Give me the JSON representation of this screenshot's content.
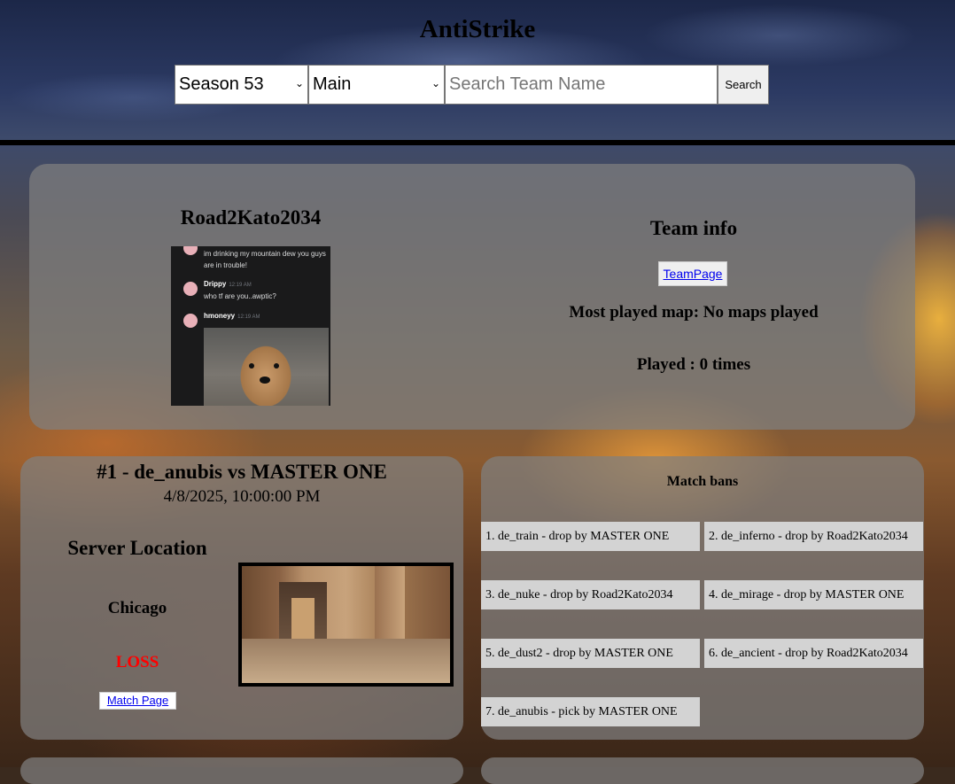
{
  "site": {
    "title": "AntiStrike"
  },
  "search": {
    "season_selected": "Season 53",
    "division_selected": "Main",
    "placeholder": "Search Team Name",
    "button_label": "Search"
  },
  "team": {
    "name": "Road2Kato2034",
    "avatar_chat": [
      {
        "name": "",
        "time": "",
        "text": "im drinking my mountain dew you guys are in trouble!"
      },
      {
        "name": "Drippy",
        "time": "12:19 AM",
        "text": "who tf are you..awptic?"
      },
      {
        "name": "hmoneyy",
        "time": "12:19 AM",
        "text": ""
      }
    ],
    "info_title": "Team info",
    "team_page_link": "TeamPage",
    "most_played": "Most played map: No maps played",
    "played": "Played : 0 times"
  },
  "match": {
    "title": "#1 - de_anubis vs MASTER ONE",
    "date": "4/8/2025, 10:00:00 PM",
    "server_title": "Server Location",
    "server_city": "Chicago",
    "result": "LOSS",
    "result_color": "#ff0000",
    "match_page_link": "Match Page"
  },
  "bans": {
    "title": "Match bans",
    "items": [
      "1. de_train - drop by MASTER ONE",
      "2. de_inferno - drop by Road2Kato2034",
      "3. de_nuke - drop by Road2Kato2034",
      "4. de_mirage - drop by MASTER ONE",
      "5. de_dust2 - drop by MASTER ONE",
      "6. de_ancient - drop by Road2Kato2034",
      "7. de_anubis - pick by MASTER ONE"
    ]
  }
}
